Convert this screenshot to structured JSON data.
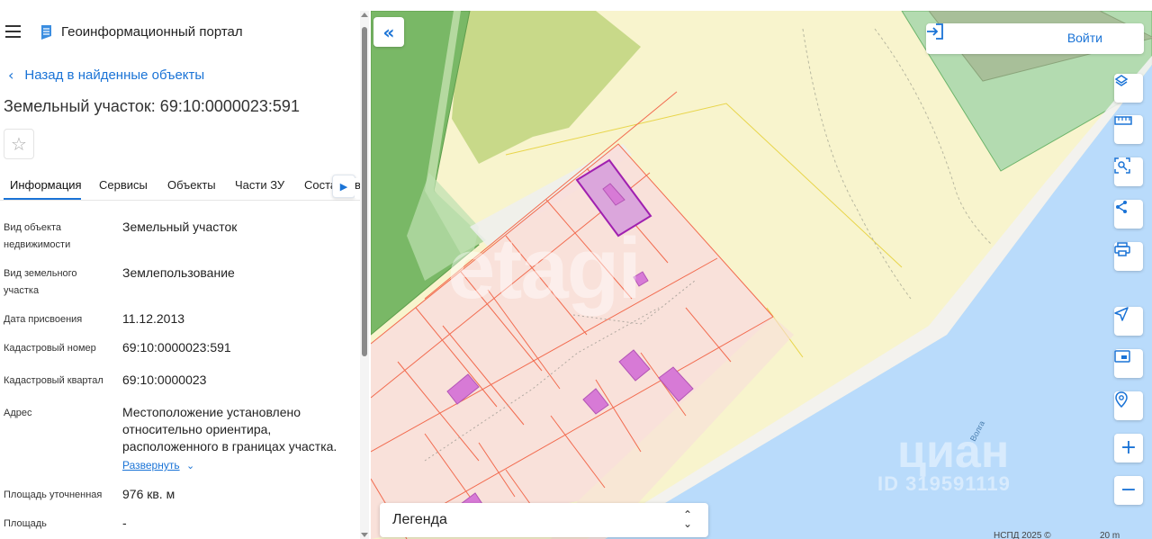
{
  "app": {
    "title": "Геоинформационный портал"
  },
  "panel": {
    "back_label": "Назад в найденные объекты",
    "object_title": "Земельный участок: 69:10:0000023:591",
    "tabs": [
      {
        "label": "Информация",
        "active": true
      },
      {
        "label": "Сервисы",
        "active": false
      },
      {
        "label": "Объекты",
        "active": false
      },
      {
        "label": "Части ЗУ",
        "active": false
      },
      {
        "label": "Соста",
        "active": false
      }
    ],
    "tab_clipped": "в",
    "properties": [
      {
        "label": "Вид объекта недвижимости",
        "value": "Земельный участок"
      },
      {
        "label": "Вид земельного участка",
        "value": "Землепользование"
      },
      {
        "label": "Дата присвоения",
        "value": "11.12.2013"
      },
      {
        "label": "Кадастровый номер",
        "value": "69:10:0000023:591"
      },
      {
        "label": "Кадастровый квартал",
        "value": "69:10:0000023"
      },
      {
        "label": "Адрес",
        "value": "Местоположение установлено относительно ориентира, расположенного в границах участка."
      },
      {
        "label": "Площадь уточненная",
        "value": "976 кв. м"
      },
      {
        "label": "Площадь",
        "value": "-"
      }
    ],
    "expand_label": "Развернуть"
  },
  "map": {
    "login_label": "Войти",
    "legend_label": "Легенда",
    "attribution": "НСПД 2025 ©",
    "scale": "20 m",
    "river_label": "Волга",
    "tools": [
      "layers-icon",
      "ruler-icon",
      "select-area-icon",
      "share-icon",
      "print-icon",
      "locate-icon",
      "basemap-icon",
      "pin-search-icon",
      "zoom-in-icon",
      "zoom-out-icon"
    ]
  },
  "watermarks": {
    "etagi": "etagi",
    "cian": "циан",
    "cian_id": "ID 319591119"
  },
  "colors": {
    "accent": "#1a73d6",
    "parcel_fill": "#f8dedb",
    "parcel_line": "#f26b4f",
    "water": "#b9dbfb",
    "forest": "#78b964",
    "selected": "#a020b0"
  }
}
